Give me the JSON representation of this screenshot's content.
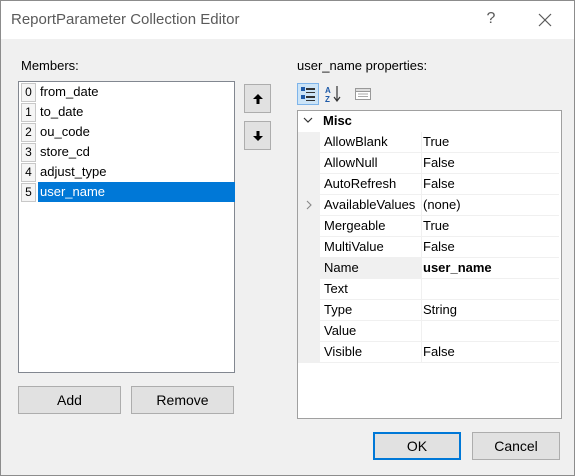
{
  "window": {
    "title": "ReportParameter Collection Editor",
    "help_glyph": "?"
  },
  "members": {
    "label": "Members:",
    "items": [
      {
        "index": "0",
        "name": "from_date"
      },
      {
        "index": "1",
        "name": "to_date"
      },
      {
        "index": "2",
        "name": "ou_code"
      },
      {
        "index": "3",
        "name": "store_cd"
      },
      {
        "index": "4",
        "name": "adjust_type"
      },
      {
        "index": "5",
        "name": "user_name"
      }
    ],
    "selected_index": 5,
    "add_label": "Add",
    "remove_label": "Remove",
    "move_up_glyph": "🡅",
    "move_down_glyph": "🡇"
  },
  "properties": {
    "label": "user_name properties:",
    "category": "Misc",
    "rows": [
      {
        "name": "AllowBlank",
        "value": "True"
      },
      {
        "name": "AllowNull",
        "value": "False"
      },
      {
        "name": "AutoRefresh",
        "value": "False"
      },
      {
        "name": "AvailableValues",
        "value": "(none)"
      },
      {
        "name": "Mergeable",
        "value": "True"
      },
      {
        "name": "MultiValue",
        "value": "False"
      },
      {
        "name": "Name",
        "value": "user_name"
      },
      {
        "name": "Text",
        "value": ""
      },
      {
        "name": "Type",
        "value": "String"
      },
      {
        "name": "Value",
        "value": ""
      },
      {
        "name": "Visible",
        "value": "False"
      }
    ],
    "selected_row": "Name",
    "expandable_row": "AvailableValues"
  },
  "footer": {
    "ok_label": "OK",
    "cancel_label": "Cancel"
  },
  "colors": {
    "selection": "#0078d7",
    "dialog_bg": "#f0f0f0"
  }
}
